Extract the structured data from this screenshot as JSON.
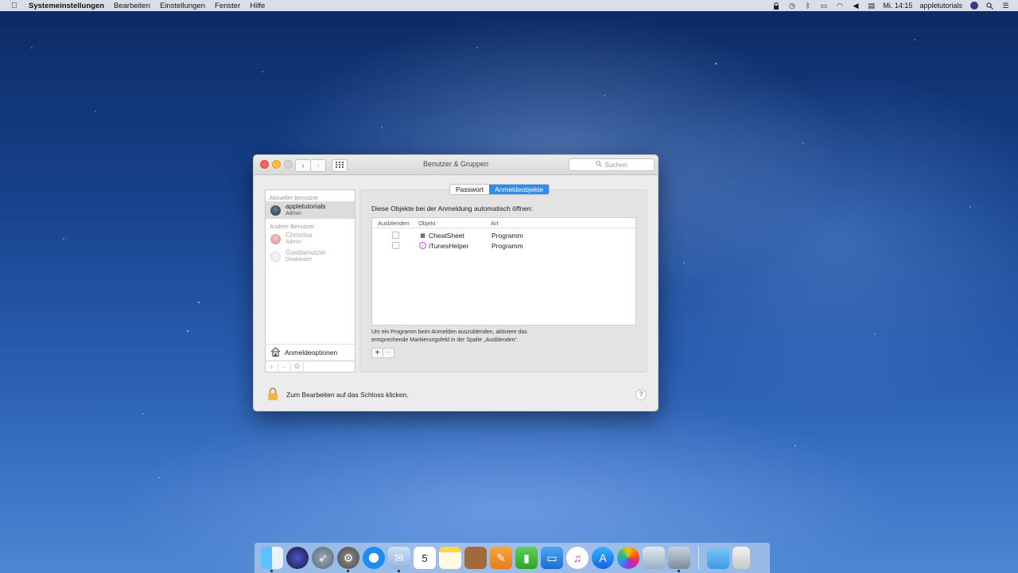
{
  "menubar": {
    "app": "Systemeinstellungen",
    "items": [
      "Bearbeiten",
      "Einstellungen",
      "Fenster",
      "Hilfe"
    ],
    "clock": "Mi. 14:15",
    "user": "appletutorials"
  },
  "window": {
    "title": "Benutzer & Gruppen",
    "search_placeholder": "Suchen"
  },
  "sidebar": {
    "current_header": "Aktueller Benutzer",
    "current_user": {
      "name": "appletutorials",
      "role": "Admin"
    },
    "others_header": "Andere Benutzer",
    "others": [
      {
        "name": "Christina",
        "role": "Admin"
      },
      {
        "name": "Gastbenutzer",
        "role": "Deaktiviert"
      }
    ],
    "login_options": "Anmeldeoptionen",
    "footer": {
      "add": "+",
      "remove": "−",
      "gear": "⚙"
    }
  },
  "tabs": [
    {
      "label": "Passwort",
      "active": false
    },
    {
      "label": "Anmeldeobjekte",
      "active": true
    }
  ],
  "main": {
    "heading": "Diese Objekte bei der Anmeldung automatisch öffnen:",
    "columns": [
      "Ausblenden",
      "Objekt",
      "Art"
    ],
    "rows": [
      {
        "name": "CheatSheet",
        "kind": "Programm",
        "hidden": false
      },
      {
        "name": "iTunesHelper",
        "kind": "Programm",
        "hidden": false
      }
    ],
    "hint_line1": "Um ein Programm beim Anmelden auszublenden, aktiviere das",
    "hint_line2": "entsprechende Markierungsfeld in der Spalte „Ausblenden“.",
    "add": "+",
    "remove": "−"
  },
  "footer": {
    "lock_text": "Zum Bearbeiten auf das Schloss klicken.",
    "help": "?"
  },
  "dock": {
    "calendar_day": "5",
    "icons": [
      "finder-icon",
      "siri-icon",
      "launchpad-icon",
      "system-preferences-icon",
      "safari-icon",
      "mail-icon",
      "calendar-icon",
      "notes-icon",
      "contacts-icon",
      "pages-icon",
      "numbers-icon",
      "keynote-icon",
      "itunes-icon",
      "app-store-icon",
      "photos-icon",
      "preview-icon",
      "image-capture-icon",
      "downloads-folder-icon",
      "trash-icon"
    ]
  }
}
